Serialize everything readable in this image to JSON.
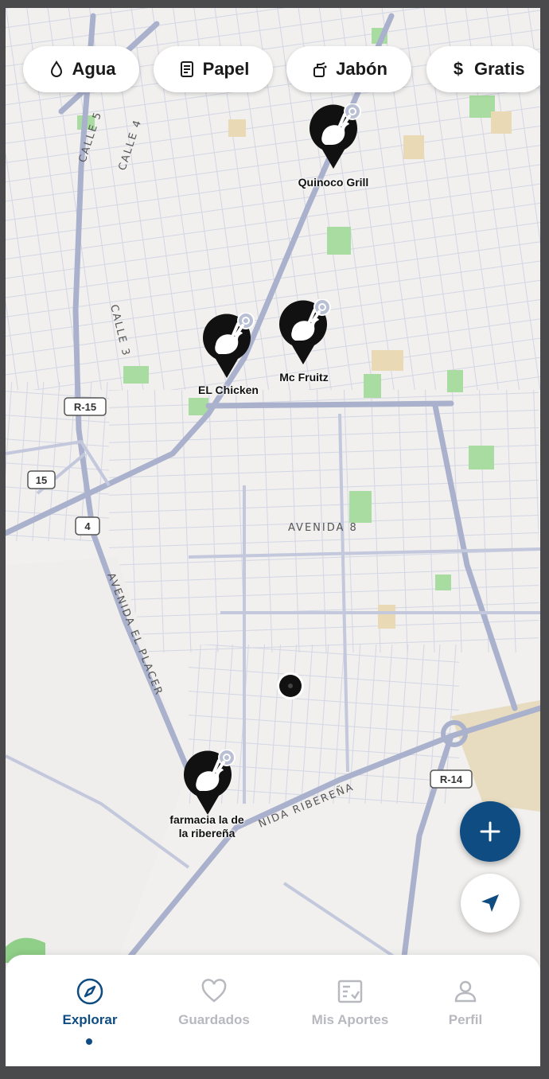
{
  "filters": [
    {
      "label": "Agua",
      "icon": "water-drop-icon"
    },
    {
      "label": "Papel",
      "icon": "paper-roll-icon"
    },
    {
      "label": "Jabón",
      "icon": "soap-icon"
    },
    {
      "label": "Gratis",
      "icon": "dollar-icon"
    }
  ],
  "map": {
    "road_labels": [
      "CALLE 5",
      "CALLE 4",
      "CALLE 3",
      "AVENIDA 8",
      "AVENIDA EL PLACER",
      "NIDA RIBEREÑA"
    ],
    "route_shields": [
      "R-15",
      "15",
      "4",
      "R-14"
    ],
    "markers": [
      {
        "name": "Quinoco Grill",
        "icon": "rabbit-icon"
      },
      {
        "name": "EL Chicken",
        "icon": "rabbit-icon"
      },
      {
        "name": "Mc Fruitz",
        "icon": "rabbit-icon"
      },
      {
        "name_line1": "farmacia la de",
        "name_line2": "la ribereña",
        "icon": "rabbit-icon"
      }
    ]
  },
  "nav": [
    {
      "label": "Explorar",
      "icon": "compass-icon",
      "active": true
    },
    {
      "label": "Guardados",
      "icon": "heart-icon",
      "active": false
    },
    {
      "label": "Mis Aportes",
      "icon": "contributions-icon",
      "active": false
    },
    {
      "label": "Perfil",
      "icon": "user-icon",
      "active": false
    }
  ],
  "colors": {
    "accent": "#0f4c81",
    "map_background": "#f1f0ee",
    "road": "#c8ccdf",
    "main_road": "#a9b0cc",
    "park": "#a8dca0",
    "marker": "#111111"
  }
}
